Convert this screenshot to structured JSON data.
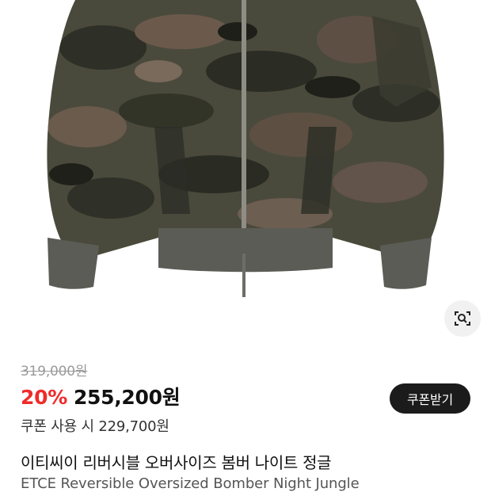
{
  "product": {
    "original_price": "319,000원",
    "discount_rate": "20%",
    "sale_price": "255,200원",
    "coupon_price_text": "쿠폰 사용 시 229,700원",
    "coupon_button_label": "쿠폰받기",
    "title_ko": "이티씨이 리버시블 오버사이즈 봄버 나이트 정글",
    "title_en": "ETCE Reversible Oversized Bomber Night Jungle"
  },
  "icons": {
    "lens": "image-search-icon"
  },
  "colors": {
    "discount": "#ef2b2b",
    "button_bg": "#1b1b1b",
    "strike_text": "#9a9a9a"
  }
}
